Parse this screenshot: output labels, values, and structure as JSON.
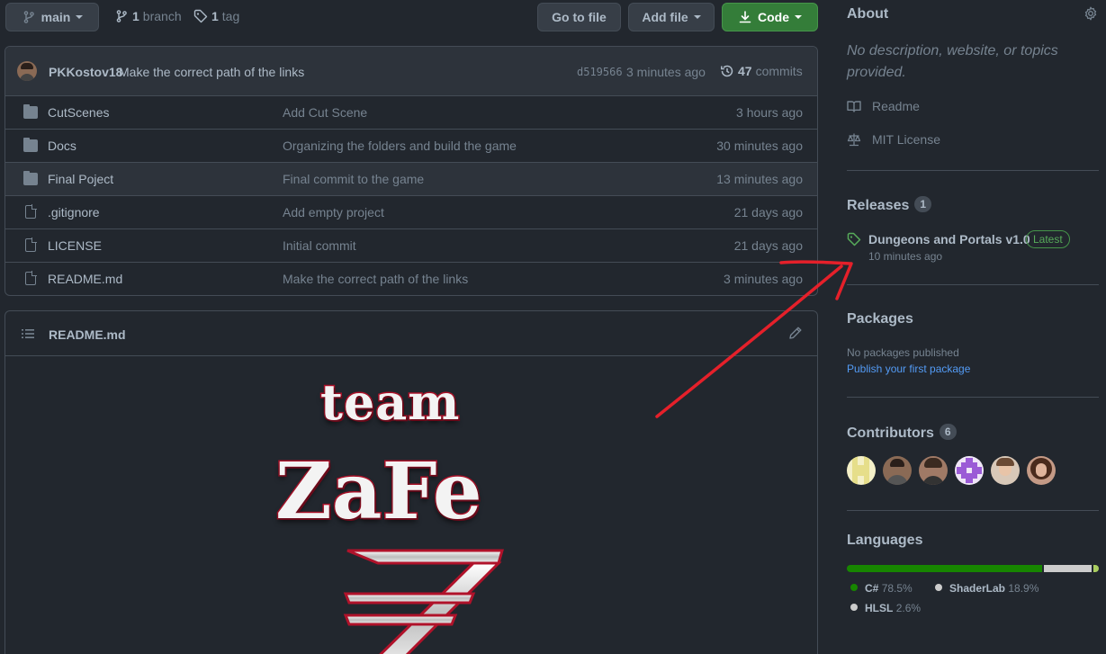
{
  "toolbar": {
    "branch": "main",
    "branch_count": "1",
    "branch_label": "branch",
    "tag_count": "1",
    "tag_label": "tag",
    "go_to_file": "Go to file",
    "add_file": "Add file",
    "code": "Code"
  },
  "commit_bar": {
    "author": "PKKostov18",
    "message": "Make the correct path of the links",
    "hash": "d519566",
    "time": "3 minutes ago",
    "count": "47",
    "count_label": "commits"
  },
  "files": [
    {
      "type": "folder",
      "name": "CutScenes",
      "message": "Add Cut Scene",
      "age": "3 hours ago"
    },
    {
      "type": "folder",
      "name": "Docs",
      "message": "Organizing the folders and build the game",
      "age": "30 minutes ago"
    },
    {
      "type": "folder",
      "name": "Final Poject",
      "message": "Final commit to the game",
      "age": "13 minutes ago"
    },
    {
      "type": "file",
      "name": ".gitignore",
      "message": "Add empty project",
      "age": "21 days ago"
    },
    {
      "type": "file",
      "name": "LICENSE",
      "message": "Initial commit",
      "age": "21 days ago"
    },
    {
      "type": "file",
      "name": "README.md",
      "message": "Make the correct path of the links",
      "age": "3 minutes ago"
    }
  ],
  "readme": {
    "title": "README.md",
    "logo_line1": "team",
    "logo_line2": "ZaFe"
  },
  "about": {
    "heading": "About",
    "description": "No description, website, or topics provided.",
    "readme_link": "Readme",
    "license_link": "MIT License"
  },
  "releases": {
    "heading": "Releases",
    "count": "1",
    "name": "Dungeons and Portals v1.0",
    "badge": "Latest",
    "time": "10 minutes ago"
  },
  "packages": {
    "heading": "Packages",
    "none": "No packages published",
    "link": "Publish your first package"
  },
  "contributors": {
    "heading": "Contributors",
    "count": "6"
  },
  "languages": {
    "heading": "Languages",
    "items": [
      {
        "name": "C#",
        "percent": "78.5%",
        "value": 78.5,
        "color": "#178600"
      },
      {
        "name": "ShaderLab",
        "percent": "18.9%",
        "value": 18.9,
        "color": "#cccccc"
      },
      {
        "name": "HLSL",
        "percent": "2.6%",
        "value": 2.6,
        "color": "#aace60"
      }
    ]
  },
  "colors": {
    "accent_link": "#539bf5",
    "green": "#347d39",
    "annotation_arrow": "#e5202a"
  }
}
